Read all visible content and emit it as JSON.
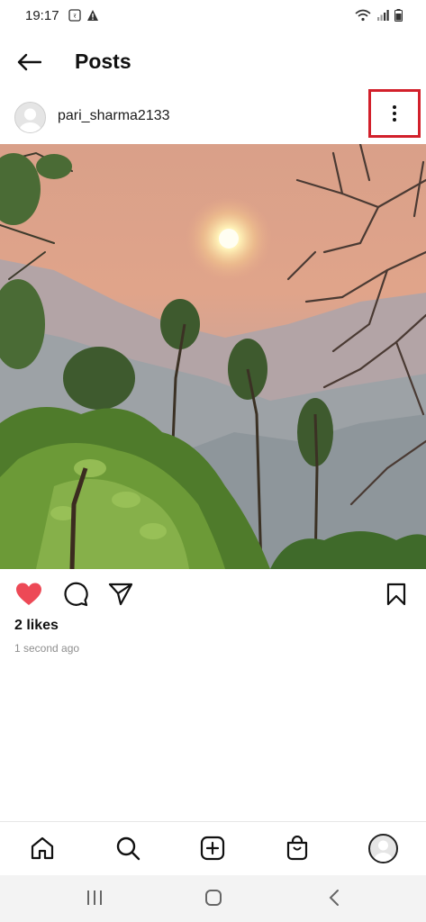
{
  "status_bar": {
    "time": "19:17",
    "left_icons": [
      "sim-icon",
      "warning-icon"
    ],
    "right_icons": [
      "wifi-icon",
      "signal-icon",
      "battery-icon"
    ]
  },
  "header": {
    "title": "Posts",
    "back_icon": "arrow-left-icon"
  },
  "post": {
    "username": "pari_sharma2133",
    "more_icon": "vertical-dots-icon",
    "highlight_color": "#d2202b",
    "image_subject": "sunset-over-hills",
    "liked": true,
    "likes_text": "2 likes",
    "timestamp": "1 second ago"
  },
  "actions": {
    "like_icon": "heart-filled-icon",
    "like_color": "#ed4956",
    "comment_icon": "comment-icon",
    "share_icon": "send-icon",
    "save_icon": "bookmark-icon"
  },
  "bottom_nav": [
    "home-icon",
    "search-icon",
    "add-post-icon",
    "shop-icon",
    "profile-avatar"
  ],
  "system_nav": [
    "recent-apps-icon",
    "home-circle-icon",
    "back-chevron-icon"
  ]
}
